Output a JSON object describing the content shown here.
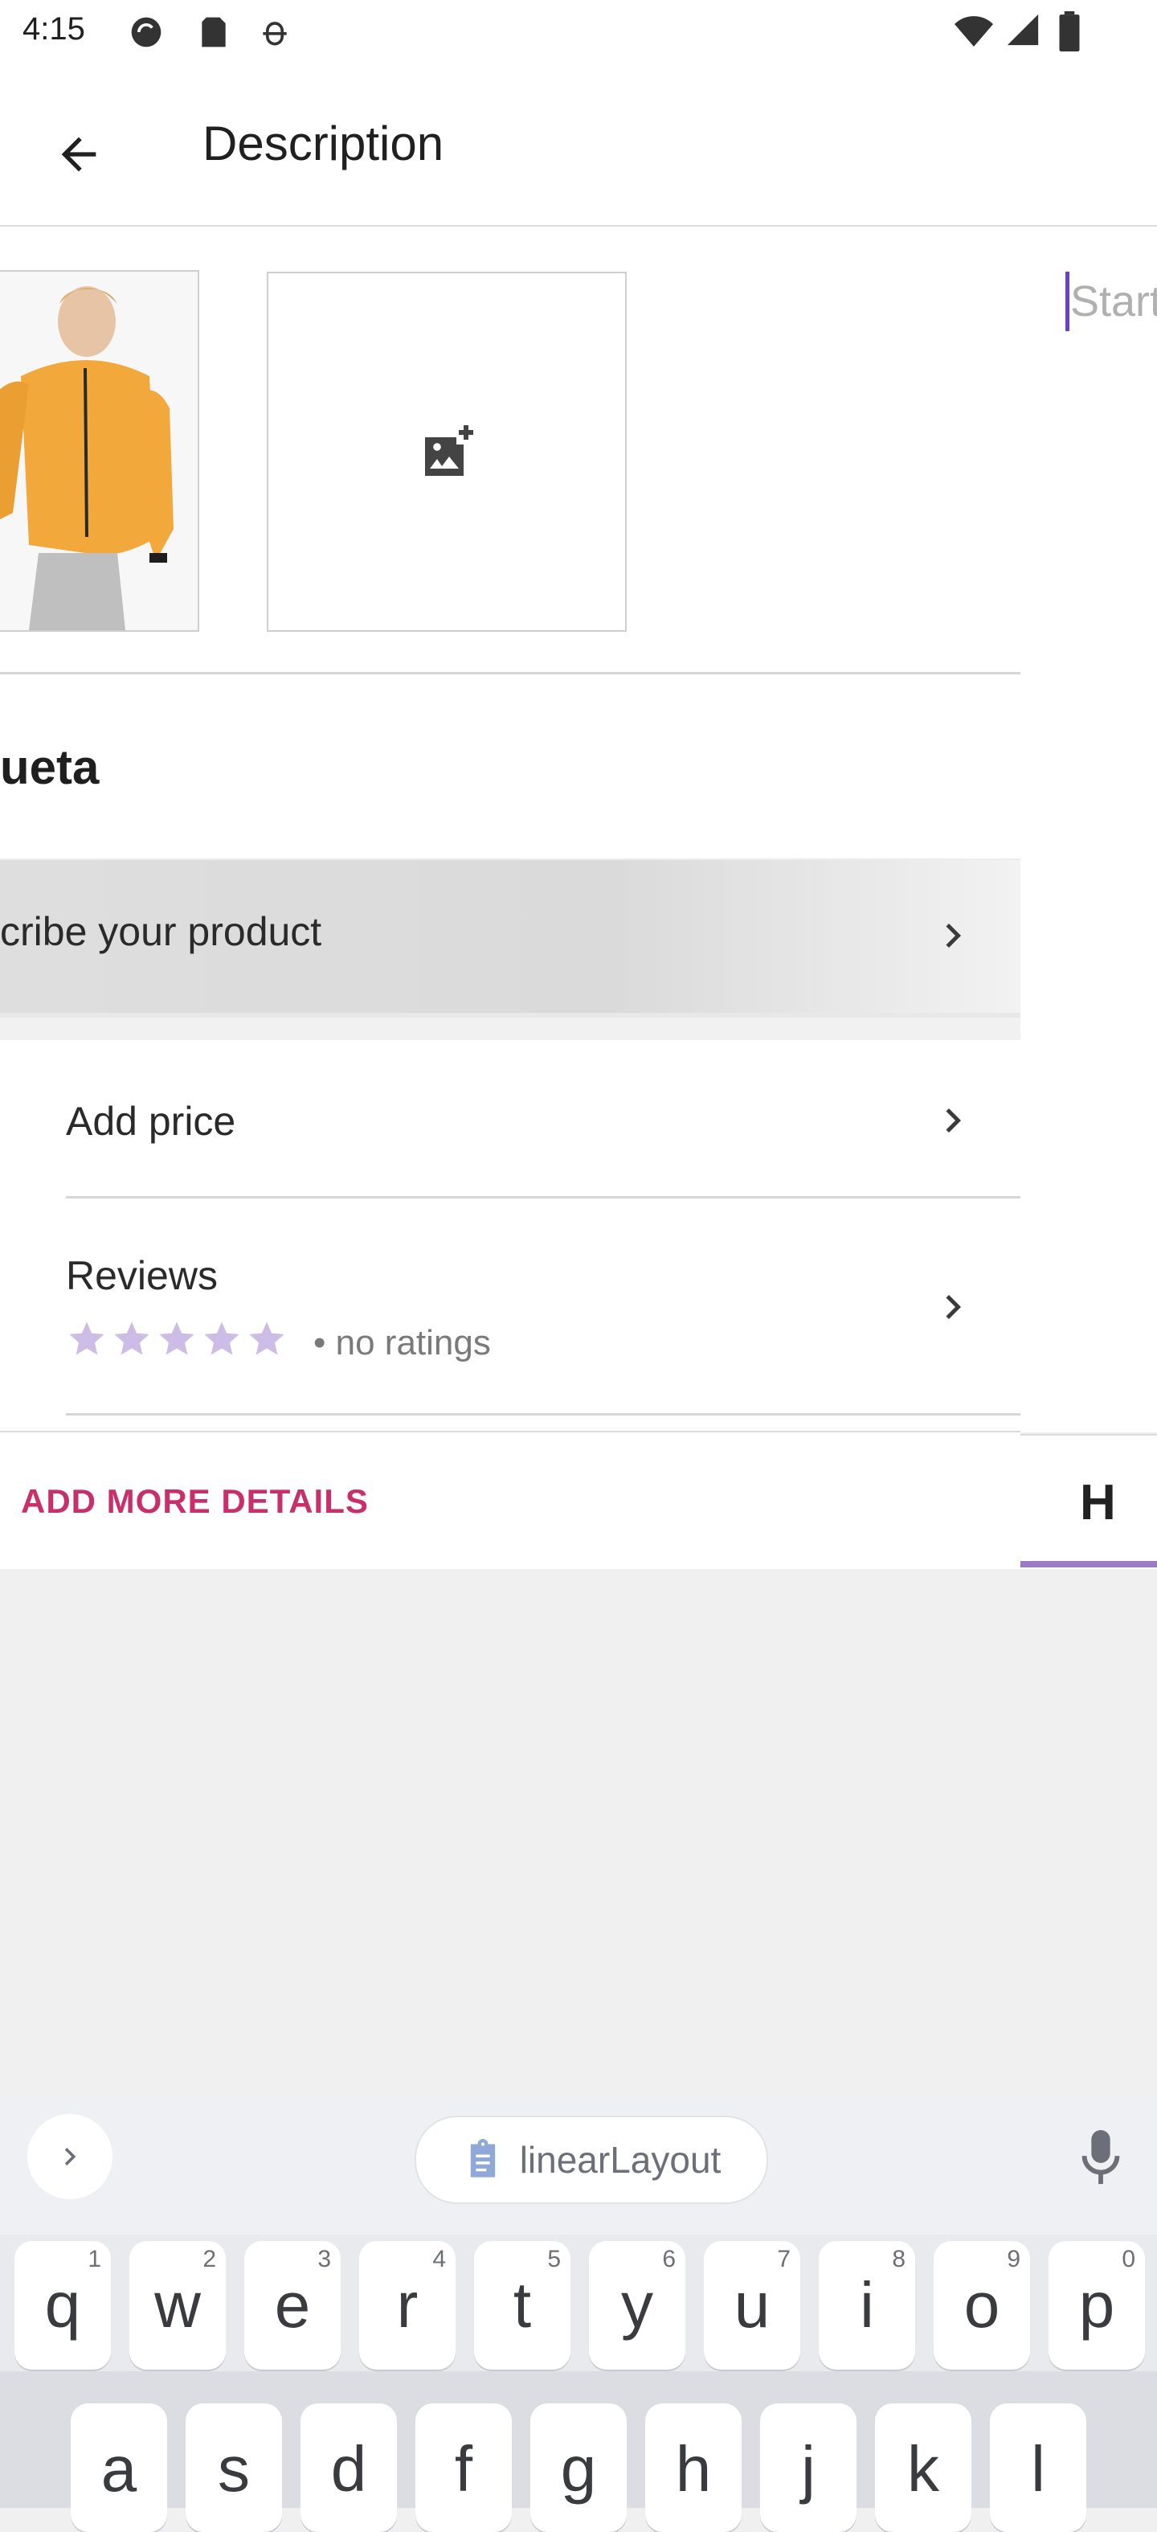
{
  "status_bar": {
    "time": "4:15"
  },
  "toolbar": {
    "title": "Description",
    "back_icon": "arrow-left-icon"
  },
  "product": {
    "name_fragment": "ueta",
    "describe_label": "cribe your product",
    "add_photo_icon": "add-photo-icon"
  },
  "rows": {
    "price_label": "Add price",
    "reviews_label": "Reviews",
    "reviews_note": "• no ratings",
    "stars_total": 5,
    "stars_filled": 0
  },
  "details": {
    "add_more_label": "ADD MORE DETAILS",
    "side_tab_letter": "H"
  },
  "editor": {
    "placeholder_fragment": "Start"
  },
  "keyboard": {
    "suggestion": "linearLayout",
    "row1": [
      {
        "ch": "q",
        "num": "1"
      },
      {
        "ch": "w",
        "num": "2"
      },
      {
        "ch": "e",
        "num": "3"
      },
      {
        "ch": "r",
        "num": "4"
      },
      {
        "ch": "t",
        "num": "5"
      },
      {
        "ch": "y",
        "num": "6"
      },
      {
        "ch": "u",
        "num": "7"
      },
      {
        "ch": "i",
        "num": "8"
      },
      {
        "ch": "o",
        "num": "9"
      },
      {
        "ch": "p",
        "num": "0"
      }
    ],
    "row2": [
      "a",
      "s",
      "d",
      "f",
      "g",
      "h",
      "j",
      "k",
      "l"
    ]
  },
  "colors": {
    "accent": "#c9306b",
    "caret": "#6a42c1",
    "star": "#cdbde6",
    "tab_underline": "#9b7cc4"
  }
}
